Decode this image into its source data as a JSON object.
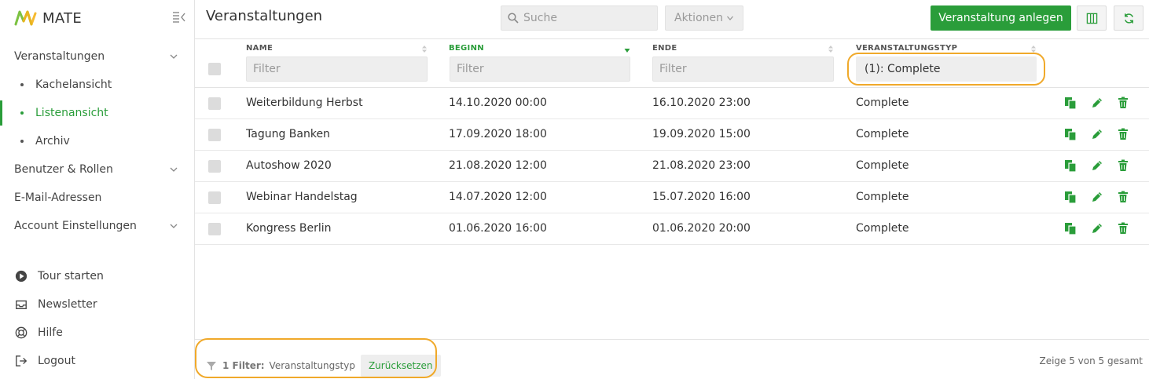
{
  "app": {
    "name": "MATE"
  },
  "sidebar": {
    "items": [
      {
        "label": "Veranstaltungen",
        "expandable": true
      },
      {
        "label": "Kachelansicht"
      },
      {
        "label": "Listenansicht",
        "active": true
      },
      {
        "label": "Archiv"
      },
      {
        "label": "Benutzer & Rollen",
        "expandable": true
      },
      {
        "label": "E-Mail-Adressen"
      },
      {
        "label": "Account Einstellungen",
        "expandable": true
      }
    ],
    "bottom": [
      {
        "label": "Tour starten",
        "icon": "play-circle-icon"
      },
      {
        "label": "Newsletter",
        "icon": "inbox-icon"
      },
      {
        "label": "Hilfe",
        "icon": "lifebuoy-icon"
      },
      {
        "label": "Logout",
        "icon": "logout-icon"
      }
    ]
  },
  "header": {
    "title": "Veranstaltungen",
    "search_placeholder": "Suche",
    "actions_label": "Aktionen",
    "create_label": "Veranstaltung anlegen"
  },
  "table": {
    "columns": [
      {
        "label": "NAME",
        "filter_placeholder": "Filter"
      },
      {
        "label": "BEGINN",
        "filter_placeholder": "Filter",
        "sorted": "desc"
      },
      {
        "label": "ENDE",
        "filter_placeholder": "Filter"
      },
      {
        "label": "VERANSTALTUNGSTYP",
        "filter_value": "(1): Complete"
      }
    ],
    "rows": [
      {
        "name": "Weiterbildung Herbst",
        "begin": "14.10.2020 00:00",
        "end": "16.10.2020 23:00",
        "type": "Complete"
      },
      {
        "name": "Tagung Banken",
        "begin": "17.09.2020 18:00",
        "end": "19.09.2020 15:00",
        "type": "Complete"
      },
      {
        "name": "Autoshow 2020",
        "begin": "21.08.2020 12:00",
        "end": "21.08.2020 23:00",
        "type": "Complete"
      },
      {
        "name": "Webinar Handelstag",
        "begin": "14.07.2020 12:00",
        "end": "15.07.2020 16:00",
        "type": "Complete"
      },
      {
        "name": "Kongress Berlin",
        "begin": "01.06.2020 16:00",
        "end": "01.06.2020 20:00",
        "type": "Complete"
      }
    ]
  },
  "footer": {
    "filter_count": "1 Filter:",
    "filter_field": "Veranstaltungstyp",
    "reset_label": "Zurücksetzen",
    "summary": "Zeige 5 von 5 gesamt"
  },
  "colors": {
    "accent": "#2a9d3a",
    "highlight": "#f0a92a"
  }
}
